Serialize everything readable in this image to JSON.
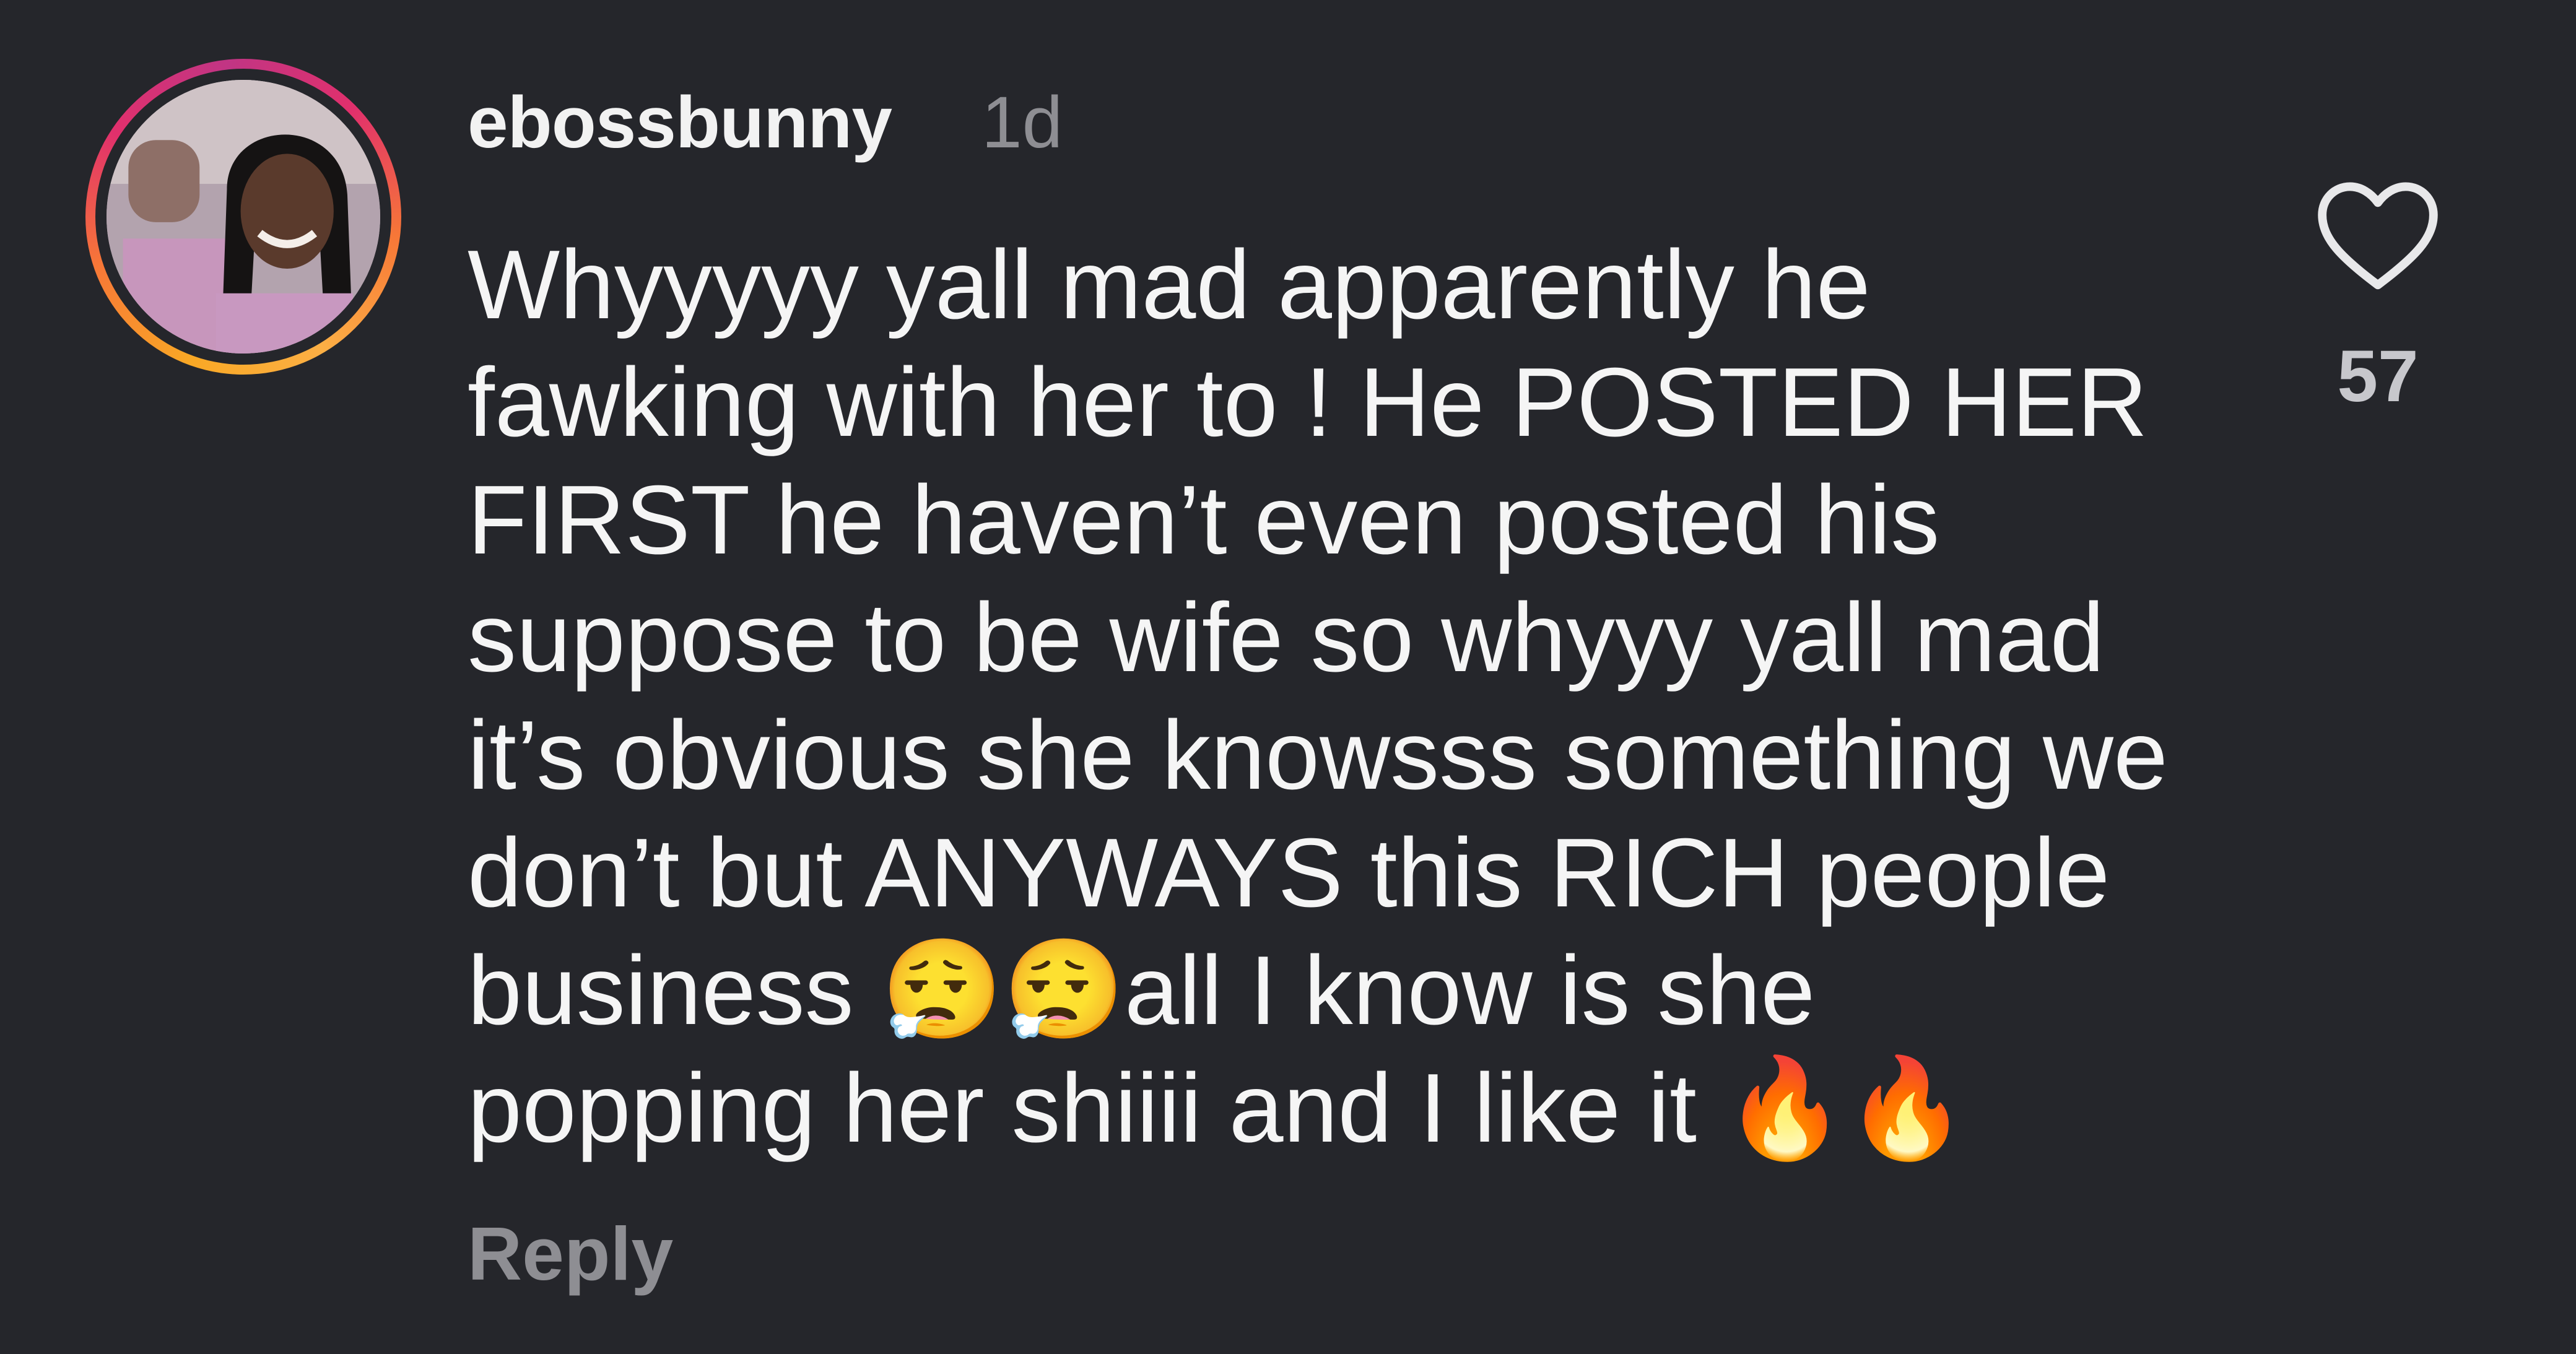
{
  "comment": {
    "username": "ebossbunny",
    "timestamp": "1d",
    "text": "Whyyyyy yall mad apparently he fawking with her to ! He POSTED HER FIRST he haven’t even posted his suppose to be wife so whyyy yall mad it’s obvious she knowsss something we don’t but ANYWAYS this RICH people business 😮‍💨😮‍💨all I know is she popping her shiiii and I like it 🔥🔥",
    "reply_label": "Reply",
    "like_count": "57",
    "like_icon": "heart-outline-icon"
  },
  "colors": {
    "background": "#25262b",
    "text_primary": "#f2f2f2",
    "text_secondary": "#8e8e93",
    "story_ring": [
      "#f9a825",
      "#f77737",
      "#e1306c",
      "#c13584"
    ]
  }
}
